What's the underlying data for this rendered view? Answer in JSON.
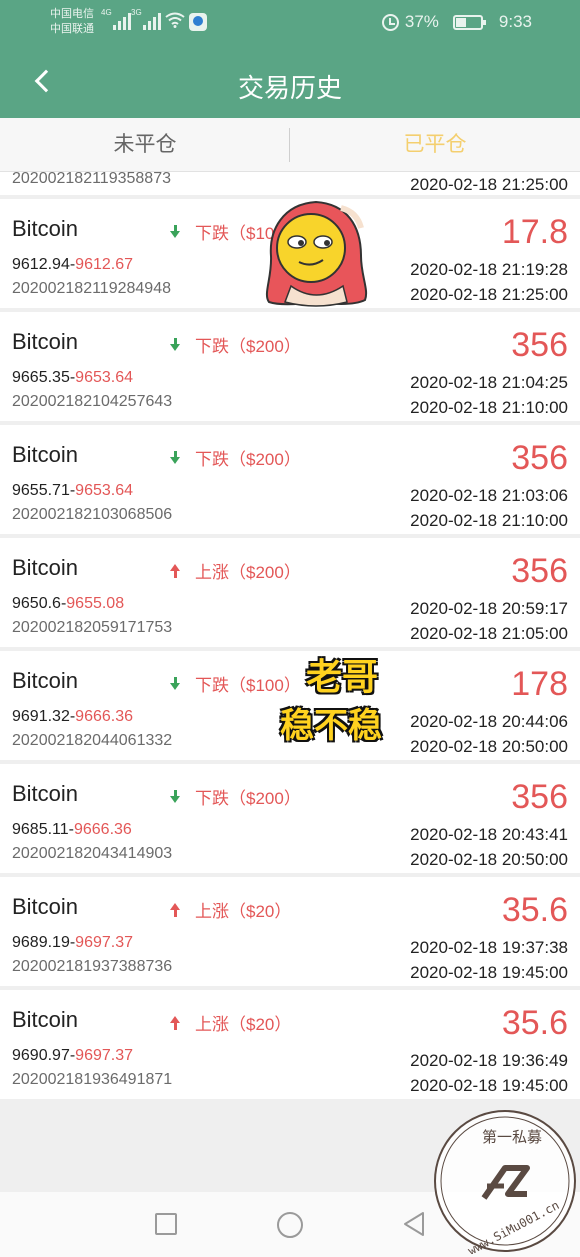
{
  "status_bar": {
    "carrier_1": "中国电信",
    "carrier_2": "中国联通",
    "net_1": "4G",
    "net_2": "3G",
    "battery": "37%",
    "time": "9:33"
  },
  "navbar": {
    "title": "交易历史"
  },
  "tabs": [
    {
      "label": "未平仓",
      "active": false
    },
    {
      "label": "已平仓",
      "active": true
    }
  ],
  "partial_row": {
    "order_id": "202002182119358873",
    "close_time": "2020-02-18 21:25:00"
  },
  "trades": [
    {
      "asset": "Bitcoin",
      "direction": "下跌（$10",
      "dir_type": "down",
      "open_price": "9612.94-",
      "close_price": "9612.67",
      "order_id": "202002182119284948",
      "profit": "17.8",
      "open_time": "2020-02-18 21:19:28",
      "close_time": "2020-02-18 21:25:00"
    },
    {
      "asset": "Bitcoin",
      "direction": "下跌（$200）",
      "dir_type": "down",
      "open_price": "9665.35-",
      "close_price": "9653.64",
      "order_id": "202002182104257643",
      "profit": "356",
      "open_time": "2020-02-18 21:04:25",
      "close_time": "2020-02-18 21:10:00"
    },
    {
      "asset": "Bitcoin",
      "direction": "下跌（$200）",
      "dir_type": "down",
      "open_price": "9655.71-",
      "close_price": "9653.64",
      "order_id": "202002182103068506",
      "profit": "356",
      "open_time": "2020-02-18 21:03:06",
      "close_time": "2020-02-18 21:10:00"
    },
    {
      "asset": "Bitcoin",
      "direction": "上涨（$200）",
      "dir_type": "up",
      "open_price": "9650.6-",
      "close_price": "9655.08",
      "order_id": "202002182059171753",
      "profit": "356",
      "open_time": "2020-02-18 20:59:17",
      "close_time": "2020-02-18 21:05:00"
    },
    {
      "asset": "Bitcoin",
      "direction": "下跌（$100）",
      "dir_type": "down",
      "open_price": "9691.32-",
      "close_price": "9666.36",
      "order_id": "202002182044061332",
      "profit": "178",
      "open_time": "2020-02-18 20:44:06",
      "close_time": "2020-02-18 20:50:00"
    },
    {
      "asset": "Bitcoin",
      "direction": "下跌（$200）",
      "dir_type": "down",
      "open_price": "9685.11-",
      "close_price": "9666.36",
      "order_id": "202002182043414903",
      "profit": "356",
      "open_time": "2020-02-18 20:43:41",
      "close_time": "2020-02-18 20:50:00"
    },
    {
      "asset": "Bitcoin",
      "direction": "上涨（$20）",
      "dir_type": "up",
      "open_price": "9689.19-",
      "close_price": "9697.37",
      "order_id": "202002181937388736",
      "profit": "35.6",
      "open_time": "2020-02-18 19:37:38",
      "close_time": "2020-02-18 19:45:00"
    },
    {
      "asset": "Bitcoin",
      "direction": "上涨（$20）",
      "dir_type": "up",
      "open_price": "9690.97-",
      "close_price": "9697.37",
      "order_id": "202002181936491871",
      "profit": "35.6",
      "open_time": "2020-02-18 19:36:49",
      "close_time": "2020-02-18 19:45:00"
    }
  ],
  "sticker_text": {
    "line1": "老哥",
    "line2": "稳不稳"
  },
  "watermark": {
    "brand": "第一私募",
    "url": "www.SiMu001.cn"
  },
  "colors": {
    "header": "#5aa585",
    "profit": "#e35757",
    "active_tab": "#f4cf6f",
    "down_arrow": "#3aa35a"
  }
}
